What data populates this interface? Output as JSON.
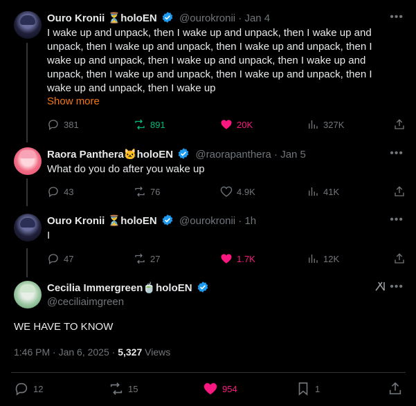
{
  "tweets": [
    {
      "name": "Ouro Kronii",
      "name_emoji": "⏳",
      "affiliation": "holoEN",
      "handle": "@ourokronii",
      "time": "· Jan 4",
      "text": "I wake up and unpack, then I wake up and unpack, then I wake up and unpack, then I wake up and unpack, then I wake up and unpack, then I wake up and unpack, then I wake up and unpack, then I wake up and unpack, then I wake up and unpack, then I wake up and unpack, then I wake up and unpack, then I wake up",
      "show_more": "Show more",
      "replies": "381",
      "reposts": "891",
      "likes": "20K",
      "views": "327K",
      "reposted": true,
      "liked": true
    },
    {
      "name": "Raora Panthera",
      "name_emoji": "🐱",
      "affiliation": "holoEN",
      "handle": "@raorapanthera",
      "time": "· Jan 5",
      "text": "What do you do after you wake up",
      "replies": "43",
      "reposts": "76",
      "likes": "4.9K",
      "views": "41K",
      "reposted": false,
      "liked": false
    },
    {
      "name": "Ouro Kronii",
      "name_emoji": "⏳",
      "affiliation": "holoEN",
      "handle": "@ourokronii",
      "time": "· 1h",
      "text": "I",
      "replies": "47",
      "reposts": "27",
      "likes": "1.7K",
      "views": "12K",
      "reposted": false,
      "liked": true
    }
  ],
  "main": {
    "name": "Cecilia Immergreen",
    "name_emoji": "🍵",
    "affiliation": "holoEN",
    "handle": "@ceciliaimgreen",
    "text": "WE HAVE TO KNOW",
    "timestamp": "1:46 PM · Jan 6, 2025 · ",
    "views_count": "5,327",
    "views_label": " Views",
    "replies": "12",
    "reposts": "15",
    "likes": "954",
    "bookmarks": "1"
  },
  "colors": {
    "background": "#000000",
    "text": "#e7e9ea",
    "muted": "#71767b",
    "like": "#f91880",
    "repost": "#00ba7c",
    "show_more": "#f4760d",
    "verified": "#1d9bf0"
  }
}
